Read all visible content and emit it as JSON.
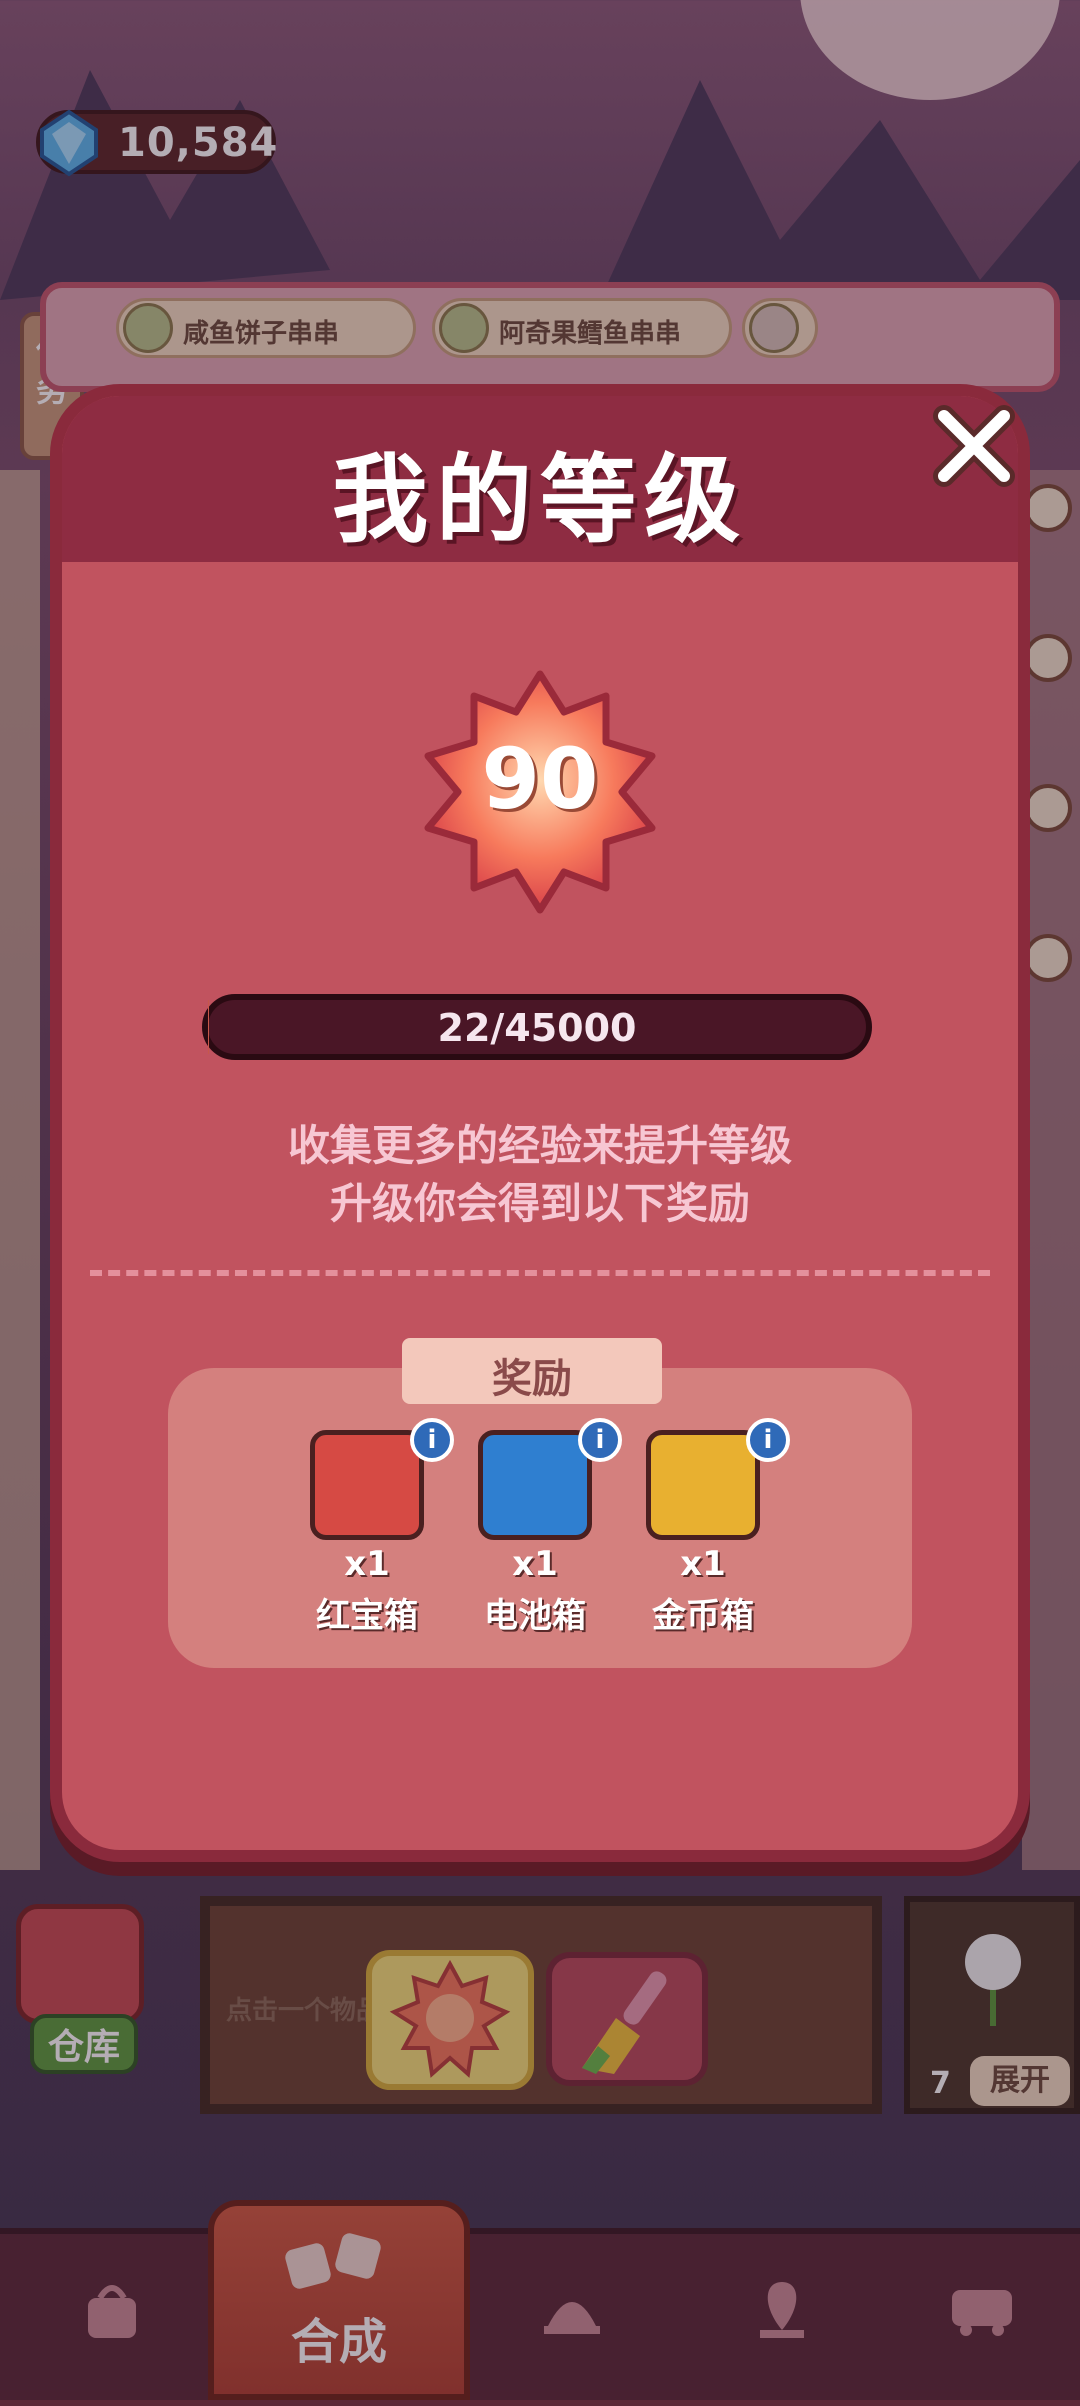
{
  "hud": {
    "gems": "10,584"
  },
  "task_tab": {
    "label": "任务"
  },
  "orders": [
    {
      "label": "咸鱼饼子串串"
    },
    {
      "label": "阿奇果鳕鱼串串"
    }
  ],
  "storage": {
    "label": "仓库"
  },
  "info_panel": {
    "text": "点击一个物品"
  },
  "right_panel": {
    "count": "7",
    "expand_label": "展开"
  },
  "nav": {
    "active_label": "合成"
  },
  "modal": {
    "title": "我的等级",
    "level": "90",
    "progress_text": "22/45000",
    "progress_fraction": 0.000489,
    "desc_line1": "收集更多的经验来提升等级",
    "desc_line2": "升级你会得到以下奖励",
    "rewards_title": "奖励",
    "rewards": [
      {
        "qty": "x1",
        "name": "红宝箱",
        "color": "#d64a44"
      },
      {
        "qty": "x1",
        "name": "电池箱",
        "color": "#2f7fd0"
      },
      {
        "qty": "x1",
        "name": "金币箱",
        "color": "#e8b030"
      }
    ]
  },
  "colors": {
    "modal_bg": "#c1535f",
    "modal_header": "#8e2c42",
    "accent": "#f4e07a"
  }
}
